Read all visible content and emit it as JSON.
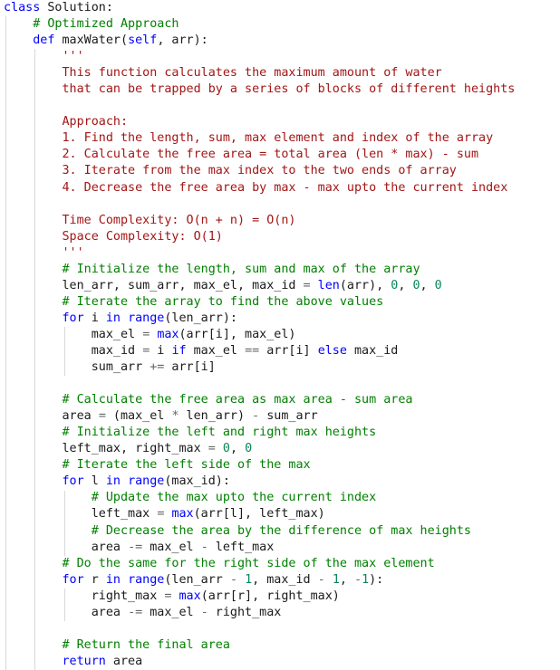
{
  "editor": {
    "colors": {
      "kw": "#0000ff",
      "comment": "#008000",
      "docstring": "#a31515",
      "number": "#098658",
      "operator": "#666666",
      "function": "#795e26",
      "text": "#1a1a1a",
      "indent_guide": "#d8d8d8"
    },
    "lines": [
      {
        "indent": 0,
        "tokens": [
          [
            "kw",
            "class"
          ],
          [
            "tx",
            " Solution:"
          ]
        ]
      },
      {
        "indent": 4,
        "tokens": [
          [
            "cm",
            "# Optimized Approach"
          ]
        ]
      },
      {
        "indent": 4,
        "tokens": [
          [
            "kw",
            "def"
          ],
          [
            "tx",
            " maxWater("
          ],
          [
            "self",
            "self"
          ],
          [
            "tx",
            ", arr):"
          ]
        ]
      },
      {
        "indent": 8,
        "tokens": [
          [
            "doc",
            "'''"
          ]
        ]
      },
      {
        "indent": 8,
        "tokens": [
          [
            "doc",
            "This function calculates the maximum amount of water"
          ]
        ]
      },
      {
        "indent": 8,
        "tokens": [
          [
            "doc",
            "that can be trapped by a series of blocks of different heights"
          ]
        ]
      },
      {
        "indent": 0,
        "tokens": []
      },
      {
        "indent": 8,
        "tokens": [
          [
            "doc",
            "Approach:"
          ]
        ]
      },
      {
        "indent": 8,
        "tokens": [
          [
            "doc",
            "1. Find the length, sum, max element and index of the array"
          ]
        ]
      },
      {
        "indent": 8,
        "tokens": [
          [
            "doc",
            "2. Calculate the free area = total area (len * max) - sum"
          ]
        ]
      },
      {
        "indent": 8,
        "tokens": [
          [
            "doc",
            "3. Iterate from the max index to the two ends of array"
          ]
        ]
      },
      {
        "indent": 8,
        "tokens": [
          [
            "doc",
            "4. Decrease the free area by max - max upto the current index"
          ]
        ]
      },
      {
        "indent": 0,
        "tokens": []
      },
      {
        "indent": 8,
        "tokens": [
          [
            "doc",
            "Time Complexity: O(n + n) = O(n)"
          ]
        ]
      },
      {
        "indent": 8,
        "tokens": [
          [
            "doc",
            "Space Complexity: O(1)"
          ]
        ]
      },
      {
        "indent": 8,
        "tokens": [
          [
            "doc",
            "'''"
          ]
        ]
      },
      {
        "indent": 8,
        "tokens": [
          [
            "cm",
            "# Initialize the length, sum and max of the array"
          ]
        ]
      },
      {
        "indent": 8,
        "tokens": [
          [
            "tx",
            "len_arr, sum_arr, max_el, max_id "
          ],
          [
            "op",
            "="
          ],
          [
            "tx",
            " "
          ],
          [
            "bi",
            "len"
          ],
          [
            "tx",
            "(arr), "
          ],
          [
            "num",
            "0"
          ],
          [
            "tx",
            ", "
          ],
          [
            "num",
            "0"
          ],
          [
            "tx",
            ", "
          ],
          [
            "num",
            "0"
          ]
        ]
      },
      {
        "indent": 8,
        "tokens": [
          [
            "cm",
            "# Iterate the array to find the above values"
          ]
        ]
      },
      {
        "indent": 8,
        "tokens": [
          [
            "kw",
            "for"
          ],
          [
            "tx",
            " i "
          ],
          [
            "kw",
            "in"
          ],
          [
            "tx",
            " "
          ],
          [
            "bi",
            "range"
          ],
          [
            "tx",
            "(len_arr):"
          ]
        ]
      },
      {
        "indent": 12,
        "tokens": [
          [
            "tx",
            "max_el "
          ],
          [
            "op",
            "="
          ],
          [
            "tx",
            " "
          ],
          [
            "bi",
            "max"
          ],
          [
            "tx",
            "(arr[i], max_el)"
          ]
        ]
      },
      {
        "indent": 12,
        "tokens": [
          [
            "tx",
            "max_id "
          ],
          [
            "op",
            "="
          ],
          [
            "tx",
            " i "
          ],
          [
            "kw",
            "if"
          ],
          [
            "tx",
            " max_el "
          ],
          [
            "op",
            "=="
          ],
          [
            "tx",
            " arr[i] "
          ],
          [
            "kw",
            "else"
          ],
          [
            "tx",
            " max_id"
          ]
        ]
      },
      {
        "indent": 12,
        "tokens": [
          [
            "tx",
            "sum_arr "
          ],
          [
            "op",
            "+="
          ],
          [
            "tx",
            " arr[i]"
          ]
        ]
      },
      {
        "indent": 0,
        "tokens": []
      },
      {
        "indent": 8,
        "tokens": [
          [
            "cm",
            "# Calculate the free area as max area - sum area"
          ]
        ]
      },
      {
        "indent": 8,
        "tokens": [
          [
            "tx",
            "area "
          ],
          [
            "op",
            "="
          ],
          [
            "tx",
            " (max_el "
          ],
          [
            "op",
            "*"
          ],
          [
            "tx",
            " len_arr) "
          ],
          [
            "op",
            "-"
          ],
          [
            "tx",
            " sum_arr"
          ]
        ]
      },
      {
        "indent": 8,
        "tokens": [
          [
            "cm",
            "# Initialize the left and right max heights"
          ]
        ]
      },
      {
        "indent": 8,
        "tokens": [
          [
            "tx",
            "left_max, right_max "
          ],
          [
            "op",
            "="
          ],
          [
            "tx",
            " "
          ],
          [
            "num",
            "0"
          ],
          [
            "tx",
            ", "
          ],
          [
            "num",
            "0"
          ]
        ]
      },
      {
        "indent": 8,
        "tokens": [
          [
            "cm",
            "# Iterate the left side of the max"
          ]
        ]
      },
      {
        "indent": 8,
        "tokens": [
          [
            "kw",
            "for"
          ],
          [
            "tx",
            " l "
          ],
          [
            "kw",
            "in"
          ],
          [
            "tx",
            " "
          ],
          [
            "bi",
            "range"
          ],
          [
            "tx",
            "(max_id):"
          ]
        ]
      },
      {
        "indent": 12,
        "tokens": [
          [
            "cm",
            "# Update the max upto the current index"
          ]
        ]
      },
      {
        "indent": 12,
        "tokens": [
          [
            "tx",
            "left_max "
          ],
          [
            "op",
            "="
          ],
          [
            "tx",
            " "
          ],
          [
            "bi",
            "max"
          ],
          [
            "tx",
            "(arr[l], left_max)"
          ]
        ]
      },
      {
        "indent": 12,
        "tokens": [
          [
            "cm",
            "# Decrease the area by the difference of max heights"
          ]
        ]
      },
      {
        "indent": 12,
        "tokens": [
          [
            "tx",
            "area "
          ],
          [
            "op",
            "-="
          ],
          [
            "tx",
            " max_el "
          ],
          [
            "op",
            "-"
          ],
          [
            "tx",
            " left_max"
          ]
        ]
      },
      {
        "indent": 8,
        "tokens": [
          [
            "cm",
            "# Do the same for the right side of the max element"
          ]
        ]
      },
      {
        "indent": 8,
        "tokens": [
          [
            "kw",
            "for"
          ],
          [
            "tx",
            " r "
          ],
          [
            "kw",
            "in"
          ],
          [
            "tx",
            " "
          ],
          [
            "bi",
            "range"
          ],
          [
            "tx",
            "(len_arr "
          ],
          [
            "op",
            "-"
          ],
          [
            "tx",
            " "
          ],
          [
            "num",
            "1"
          ],
          [
            "tx",
            ", max_id "
          ],
          [
            "op",
            "-"
          ],
          [
            "tx",
            " "
          ],
          [
            "num",
            "1"
          ],
          [
            "tx",
            ", "
          ],
          [
            "op",
            "-"
          ],
          [
            "num",
            "1"
          ],
          [
            "tx",
            "):"
          ]
        ]
      },
      {
        "indent": 12,
        "tokens": [
          [
            "tx",
            "right_max "
          ],
          [
            "op",
            "="
          ],
          [
            "tx",
            " "
          ],
          [
            "bi",
            "max"
          ],
          [
            "tx",
            "(arr[r], right_max)"
          ]
        ]
      },
      {
        "indent": 12,
        "tokens": [
          [
            "tx",
            "area "
          ],
          [
            "op",
            "-="
          ],
          [
            "tx",
            " max_el "
          ],
          [
            "op",
            "-"
          ],
          [
            "tx",
            " right_max"
          ]
        ]
      },
      {
        "indent": 0,
        "tokens": []
      },
      {
        "indent": 8,
        "tokens": [
          [
            "cm",
            "# Return the final area"
          ]
        ]
      },
      {
        "indent": 8,
        "tokens": [
          [
            "kw",
            "return"
          ],
          [
            "tx",
            " area"
          ]
        ]
      }
    ]
  }
}
